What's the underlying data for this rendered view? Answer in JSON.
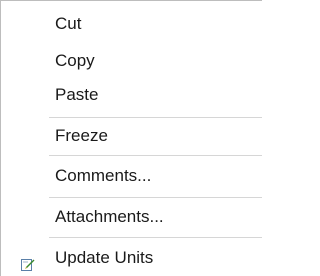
{
  "context_menu": {
    "items": [
      {
        "label": "Cut"
      },
      {
        "label": "Copy"
      },
      {
        "label": "Paste"
      },
      {
        "label": "Freeze"
      },
      {
        "label": "Comments..."
      },
      {
        "label": "Attachments..."
      },
      {
        "label": "Update Units",
        "icon": "edit-pencil-icon"
      }
    ]
  },
  "colors": {
    "separator": "#d6d6d6",
    "border": "#bdbdbd",
    "icon_pencil": "#3a8a2e"
  }
}
